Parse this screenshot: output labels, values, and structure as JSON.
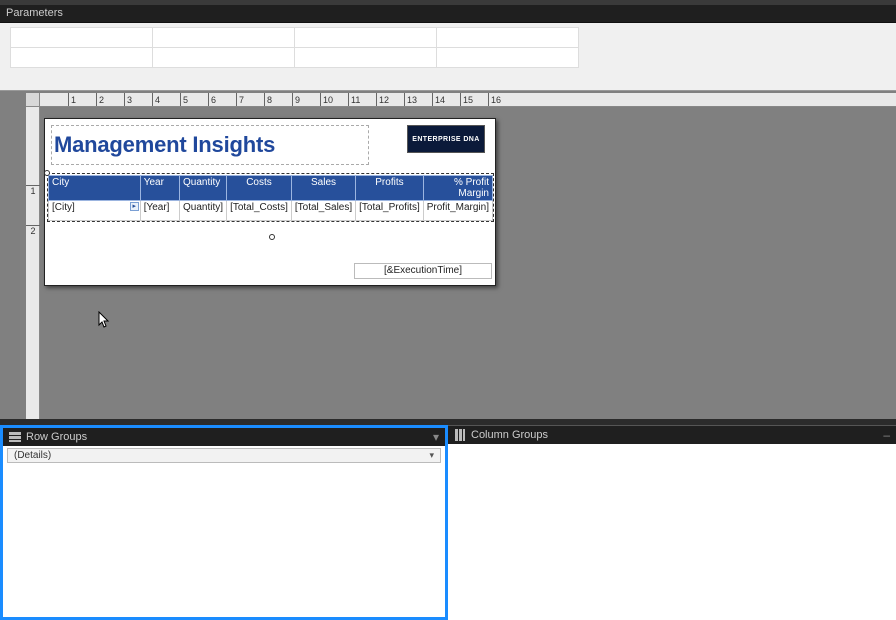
{
  "parameters": {
    "header": "Parameters"
  },
  "ruler": {
    "h_labels": [
      "1",
      "2",
      "3",
      "4",
      "5",
      "6",
      "7",
      "8",
      "9",
      "10",
      "11",
      "12",
      "13",
      "14",
      "15",
      "16"
    ],
    "v_labels": [
      "1",
      "2"
    ]
  },
  "report": {
    "title": "Management Insights",
    "logo_text": "ENTERPRISE DNA",
    "table": {
      "headers": {
        "city": "City",
        "year": "Year",
        "quantity": "Quantity",
        "costs": "Costs",
        "sales": "Sales",
        "profits": "Profits",
        "profit_margin": "% Profit Margin"
      },
      "row": {
        "city": "[City]",
        "year": "[Year]",
        "quantity": "Quantity]",
        "costs": "[Total_Costs]",
        "sales": "[Total_Sales]",
        "profits": "[Total_Profits]",
        "profit_margin": "Profit_Margin]"
      }
    },
    "exec_time": "[&ExecutionTime]"
  },
  "groups": {
    "row_header": "Row Groups",
    "col_header": "Column Groups",
    "details_item": "(Details)"
  }
}
